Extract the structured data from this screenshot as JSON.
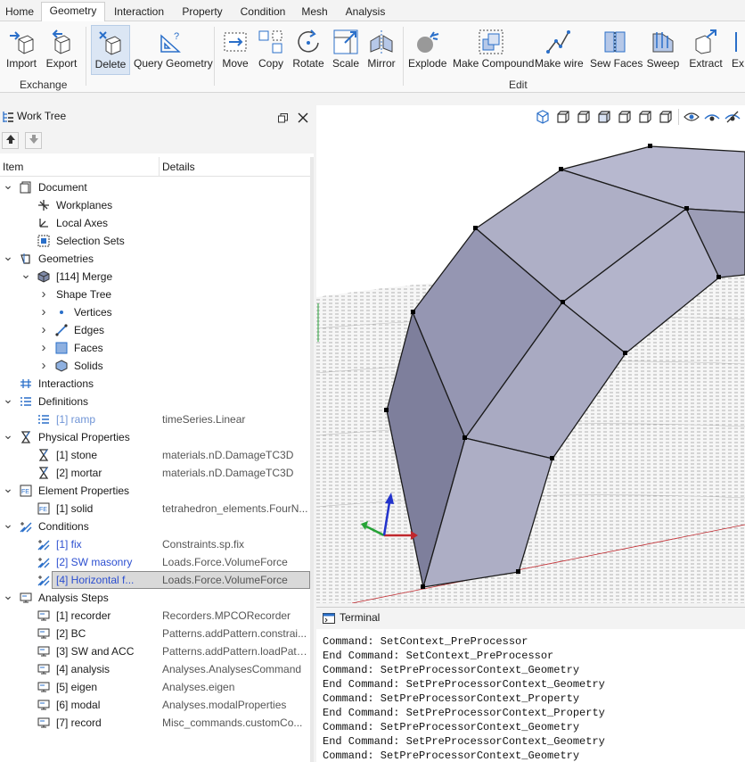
{
  "ribbon_tabs": [
    "Home",
    "Geometry",
    "Interaction",
    "Property",
    "Condition",
    "Mesh",
    "Analysis"
  ],
  "active_tab": "Geometry",
  "ribbon": {
    "import": "Import",
    "export": "Export",
    "delete": "Delete",
    "query_geometry": "Query Geometry",
    "move": "Move",
    "copy": "Copy",
    "rotate": "Rotate",
    "scale": "Scale",
    "mirror": "Mirror",
    "explode": "Explode",
    "make_compound": "Make Compound",
    "make_wire": "Make wire",
    "sew_faces": "Sew Faces",
    "sweep": "Sweep",
    "extract": "Extract",
    "ex_cut": "Ex",
    "group_exchange": "Exchange",
    "group_edit": "Edit"
  },
  "work_tree": {
    "title": "Work Tree",
    "col_item": "Item",
    "col_details": "Details",
    "rows": [
      {
        "label": "Document",
        "details": ""
      },
      {
        "label": "Workplanes",
        "details": ""
      },
      {
        "label": "Local Axes",
        "details": ""
      },
      {
        "label": "Selection Sets",
        "details": ""
      },
      {
        "label": "Geometries",
        "details": ""
      },
      {
        "label": "[114] Merge",
        "details": ""
      },
      {
        "label": "Shape Tree",
        "details": ""
      },
      {
        "label": "Vertices",
        "details": ""
      },
      {
        "label": "Edges",
        "details": ""
      },
      {
        "label": "Faces",
        "details": ""
      },
      {
        "label": "Solids",
        "details": ""
      },
      {
        "label": "Interactions",
        "details": ""
      },
      {
        "label": "Definitions",
        "details": ""
      },
      {
        "label": "[1] ramp",
        "details": "timeSeries.Linear"
      },
      {
        "label": "Physical Properties",
        "details": ""
      },
      {
        "label": "[1] stone",
        "details": "materials.nD.DamageTC3D"
      },
      {
        "label": "[2] mortar",
        "details": "materials.nD.DamageTC3D"
      },
      {
        "label": "Element Properties",
        "details": ""
      },
      {
        "label": "[1] solid",
        "details": "tetrahedron_elements.FourN..."
      },
      {
        "label": "Conditions",
        "details": ""
      },
      {
        "label": "[1] fix",
        "details": "Constraints.sp.fix"
      },
      {
        "label": "[2] SW masonry",
        "details": "Loads.Force.VolumeForce"
      },
      {
        "label": "[4] Horizontal f...",
        "details": "Loads.Force.VolumeForce"
      },
      {
        "label": "Analysis Steps",
        "details": ""
      },
      {
        "label": "[1] recorder",
        "details": "Recorders.MPCORecorder"
      },
      {
        "label": "[2] BC",
        "details": "Patterns.addPattern.constrai..."
      },
      {
        "label": "[3] SW and ACC",
        "details": "Patterns.addPattern.loadPatt..."
      },
      {
        "label": "[4] analysis",
        "details": "Analyses.AnalysesCommand"
      },
      {
        "label": "[5] eigen",
        "details": "Analyses.eigen"
      },
      {
        "label": "[6] modal",
        "details": "Analyses.modalProperties"
      },
      {
        "label": "[7] record",
        "details": "Misc_commands.customCo..."
      }
    ]
  },
  "terminal": {
    "title": "Terminal",
    "lines": [
      "Command: SetContext_PreProcessor",
      "End Command: SetContext_PreProcessor",
      "Command: SetPreProcessorContext_Geometry",
      "End Command: SetPreProcessorContext_Geometry",
      "Command: SetPreProcessorContext_Property",
      "End Command: SetPreProcessorContext_Property",
      "Command: SetPreProcessorContext_Geometry",
      "End Command: SetPreProcessorContext_Geometry",
      "Command: SetPreProcessorContext_Geometry"
    ]
  },
  "colors": {
    "accent": "#2a6fc9",
    "selection": "#d9d9d9",
    "shape_face": "#a9aac2",
    "axis_x": "#c0272d",
    "axis_y": "#25a336",
    "axis_z": "#2233cc"
  }
}
